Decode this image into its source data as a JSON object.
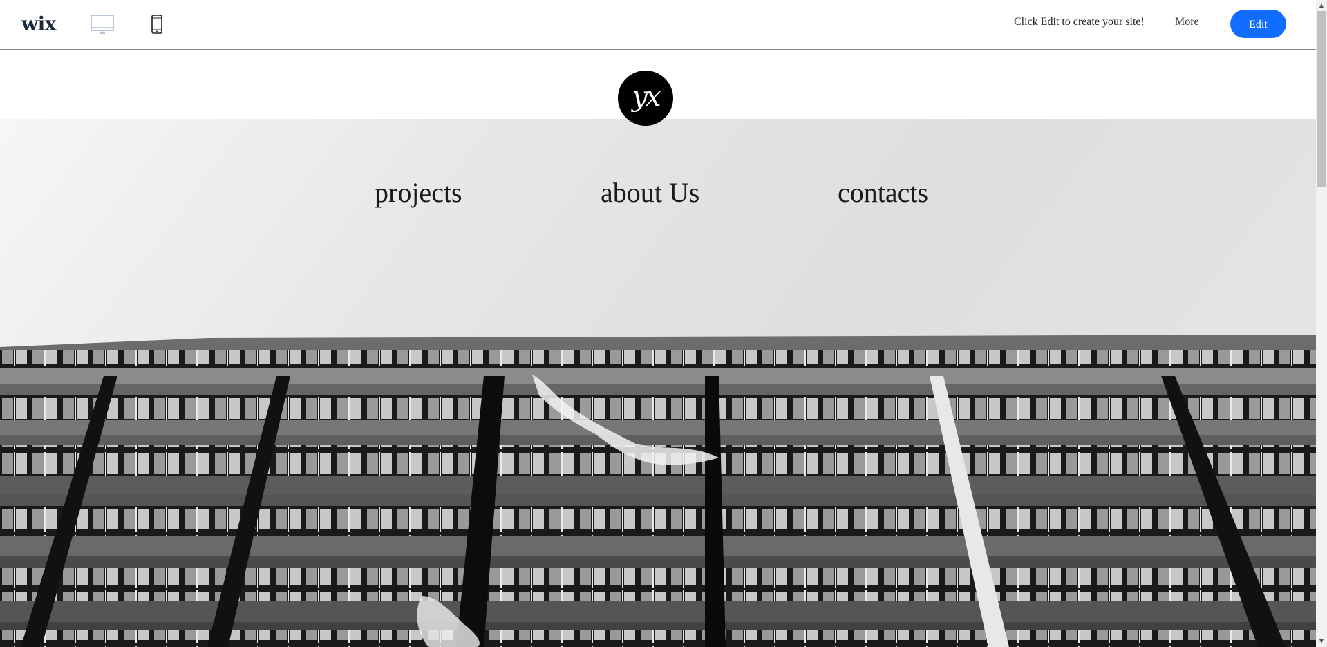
{
  "topbar": {
    "logo_text": "wix",
    "promo_text": "Click Edit to create your site!",
    "more_label": "More",
    "edit_label": "Edit",
    "edit_color": "#116dff",
    "desktop_icon": "desktop-icon",
    "mobile_icon": "mobile-icon"
  },
  "site": {
    "logo_text": "yx",
    "nav": [
      {
        "label": "projects"
      },
      {
        "label": "about Us"
      },
      {
        "label": "contacts"
      }
    ],
    "hero_image": "black-and-white-building-facade"
  }
}
